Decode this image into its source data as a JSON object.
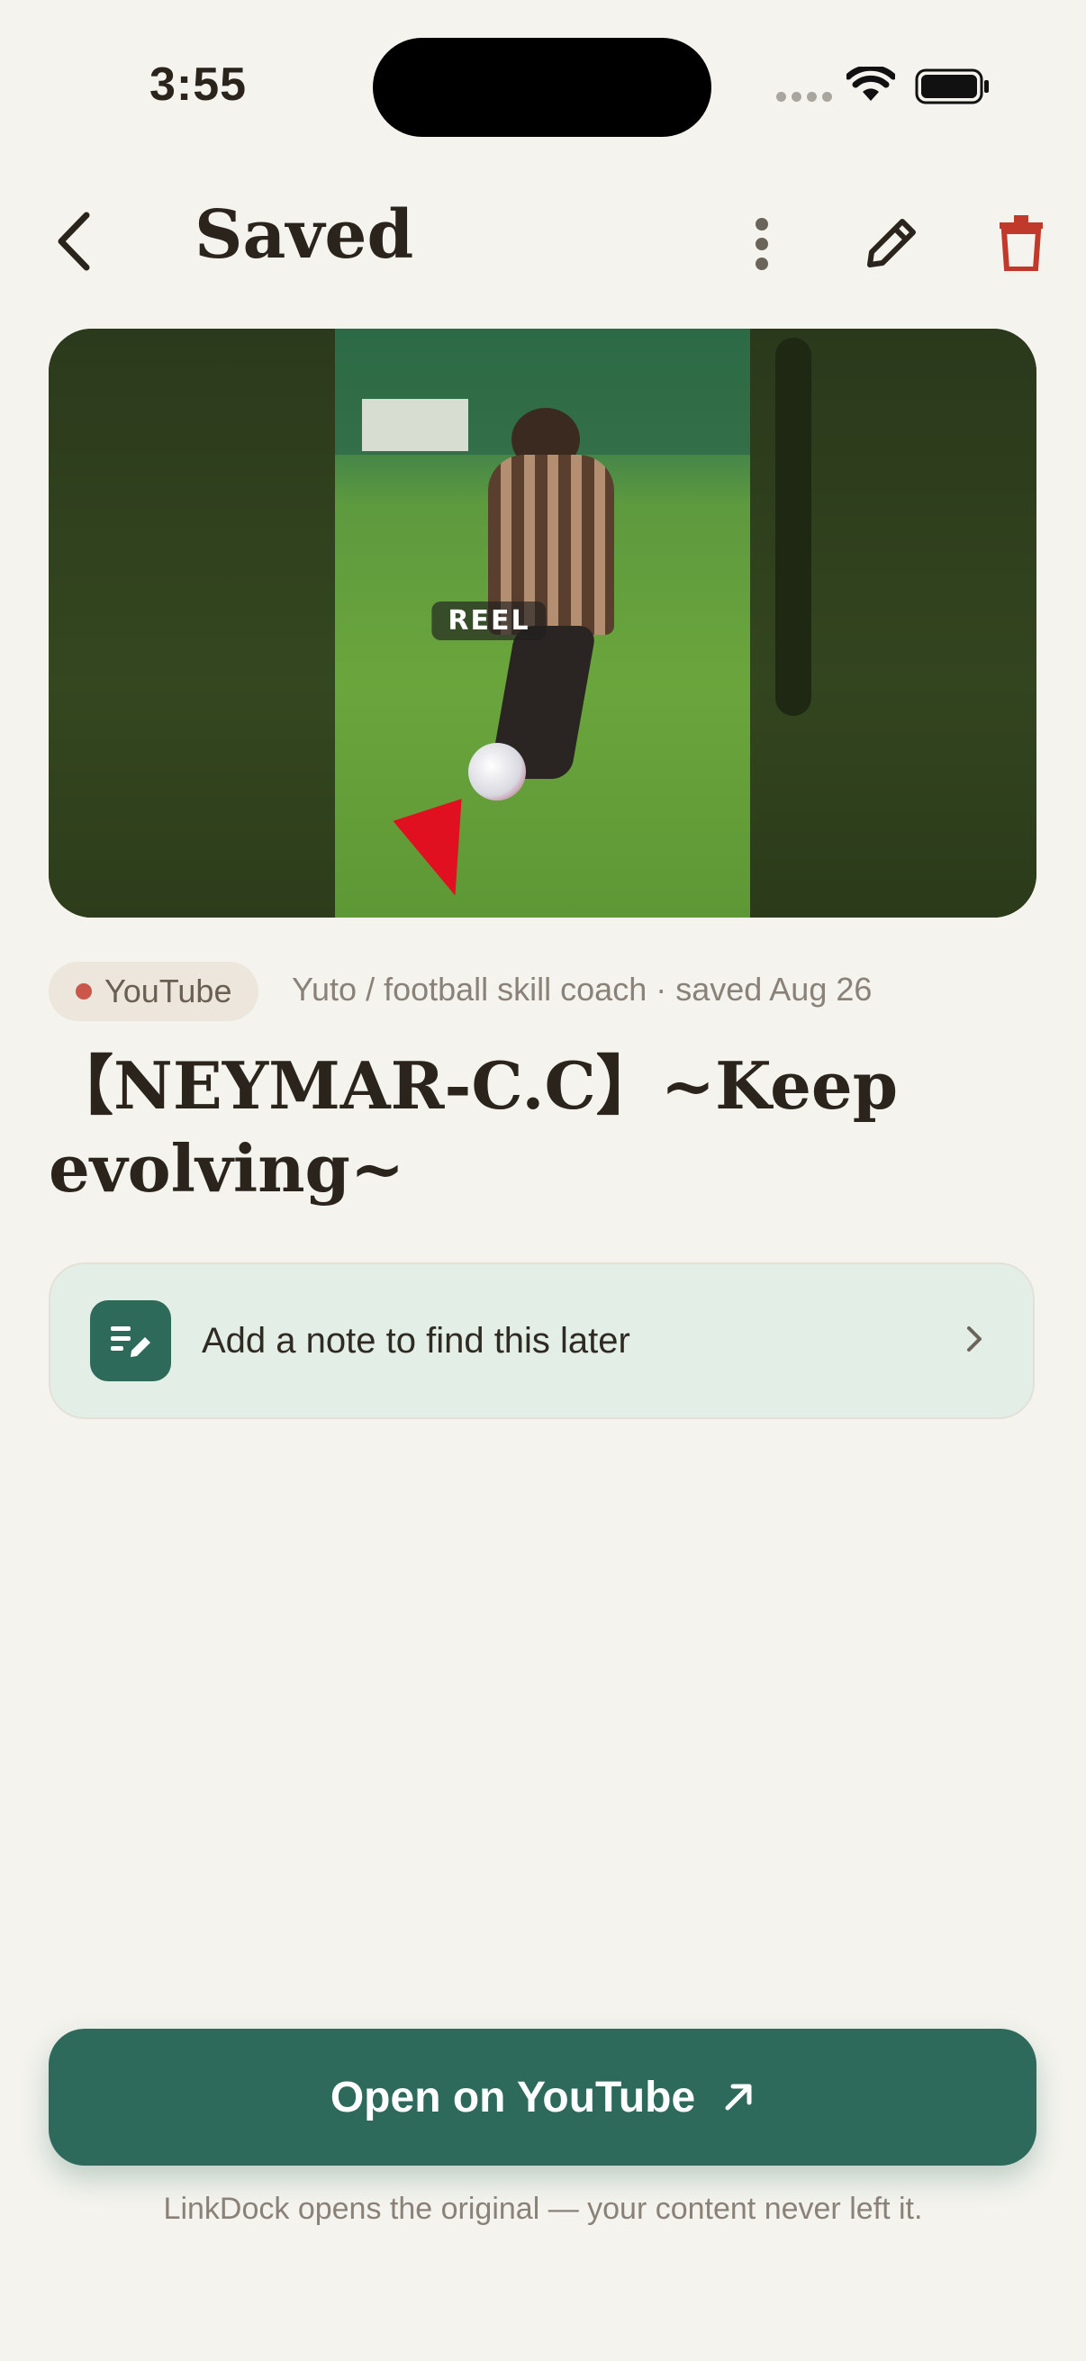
{
  "status_bar": {
    "time": "3:55"
  },
  "header": {
    "title": "Saved"
  },
  "media": {
    "badge": "REEL"
  },
  "meta": {
    "source": "YouTube",
    "info": "Yuto /  football skill coach · saved Aug 26",
    "source_color": "#c9574a"
  },
  "post": {
    "title": "【NEYMAR-C.C】~Keep evolving~"
  },
  "note": {
    "prompt": "Add a note to find this later"
  },
  "cta": {
    "label": "Open on YouTube"
  },
  "footer": {
    "text": "LinkDock opens the original — your content never left it."
  },
  "colors": {
    "accent": "#2e6a5b",
    "delete": "#c0392b",
    "background": "#f4f3ee"
  },
  "icons": [
    "back-chevron-icon",
    "more-vertical-icon",
    "pencil-icon",
    "trash-icon",
    "note-edit-icon",
    "chevron-right-icon",
    "arrow-up-right-icon",
    "wifi-icon",
    "battery-icon",
    "signal-icon"
  ]
}
